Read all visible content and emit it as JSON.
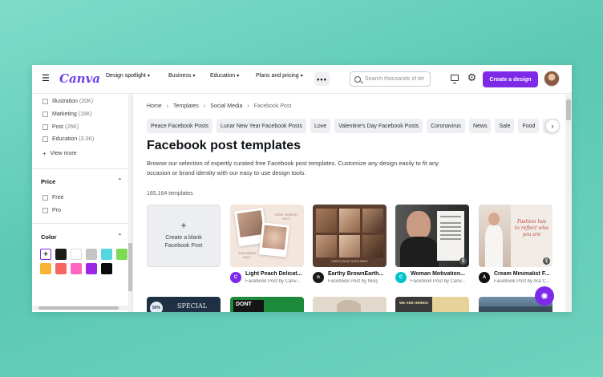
{
  "topbar": {
    "logo": "Canva",
    "nav": [
      {
        "label": "Design spotlight"
      },
      {
        "label": "Business"
      },
      {
        "label": "Education"
      },
      {
        "label": "Plans and pricing"
      }
    ],
    "more_label": "•••",
    "search_placeholder": "Search thousands of ter",
    "create_label": "Create a design"
  },
  "sidebar": {
    "categories": [
      {
        "label": "Illustration",
        "count": "(20K)"
      },
      {
        "label": "Marketing",
        "count": "(16K)"
      },
      {
        "label": "Post",
        "count": "(26K)"
      },
      {
        "label": "Education",
        "count": "(3.3K)"
      }
    ],
    "view_more": "View more",
    "price_heading": "Price",
    "price_options": [
      "Free",
      "Pro"
    ],
    "color_heading": "Color",
    "colors": [
      "multicolor",
      "#1c1c1c",
      "#ffffff",
      "#c4c4c4",
      "#55d6df",
      "#7ed957",
      "#f9b232",
      "#f66561",
      "#ff66c4",
      "#9b26e8",
      "#0a0a0a"
    ]
  },
  "main": {
    "breadcrumb": [
      "Home",
      "Templates",
      "Social Media",
      "Facebook Post"
    ],
    "chips": [
      "Peace Facebook Posts",
      "Lunar New Year Facebook Posts",
      "Love",
      "Valentine's Day Facebook Posts",
      "Coronavirus",
      "News",
      "Sale",
      "Food",
      "Bir"
    ],
    "title": "Facebook post templates",
    "description": "Browse our selection of expertly curated free Facebook post templates. Customize any design easily to fit any occasion or brand identity with our easy to use design tools.",
    "count": "165,164 templates",
    "blank_card": "Create a blank Facebook Post",
    "blank_plus": "+",
    "templates": [
      {
        "title": "Light Peach Delicat...",
        "subtitle": "Facebook Post by Canv...",
        "logo_color": "#7d2ae8",
        "logo_text": "C"
      },
      {
        "title": "Earthy BrownEarth...",
        "subtitle": "Facebook Post by Nisq",
        "logo_color": "#1a1a1a",
        "logo_text": "n"
      },
      {
        "title": "Woman Motivation...",
        "subtitle": "Facebook Post by Canv...",
        "logo_color": "#00c4cc",
        "logo_text": "C"
      },
      {
        "title": "Cream Minimalist F...",
        "subtitle": "Facebook Post by Ara C...",
        "logo_color": "#111111",
        "logo_text": "A"
      }
    ],
    "thumb_texts": {
      "t1_banner": "TEXT WITH LOVE",
      "t1_promo": "NEW SPRING HOT",
      "t1_sub": "THIS WEEK ONLY",
      "t2_caption": "HERE'S WHAT SHE'S NEED",
      "t4_script": "Fashion has to reflect who you are",
      "r2_a": "50%",
      "r2_b": "SPECIAL",
      "r2_c": "DONT",
      "r2_d": "WE ARE HIRING!"
    }
  }
}
